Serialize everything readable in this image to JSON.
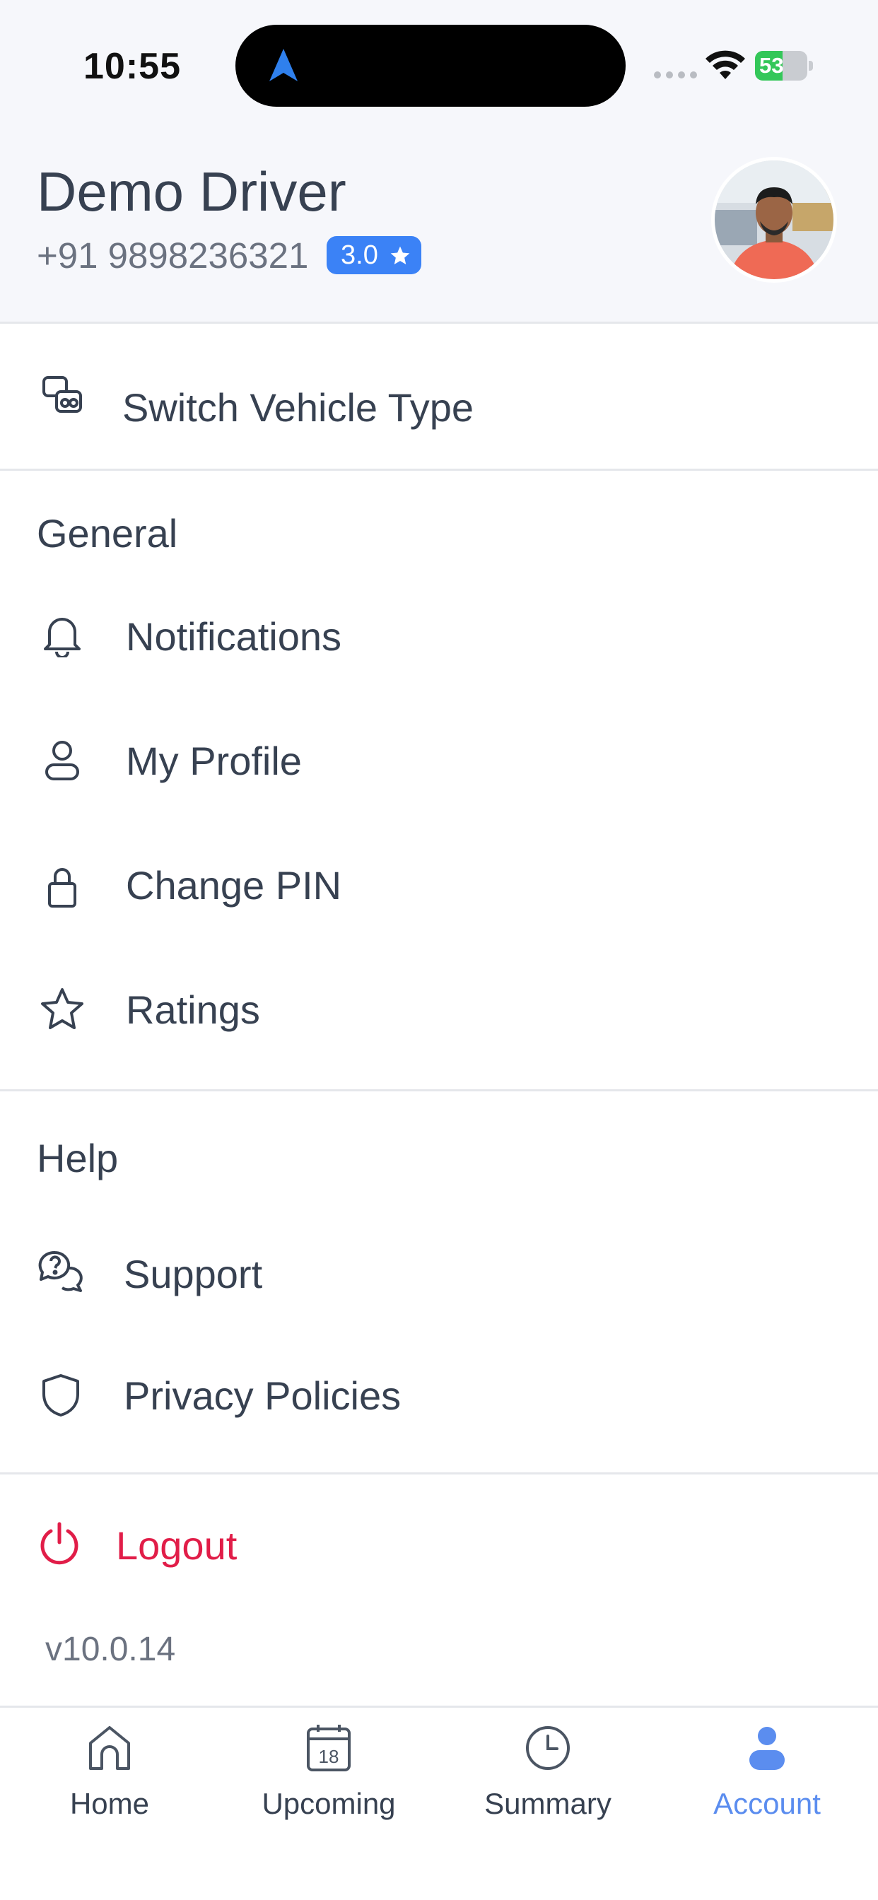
{
  "status_bar": {
    "time": "10:55",
    "battery_percent": "53",
    "battery_level": 0.53
  },
  "profile": {
    "name": "Demo Driver",
    "phone": "+91 9898236321",
    "rating": "3.0"
  },
  "menu": {
    "switch_vehicle": "Switch Vehicle Type",
    "general_title": "General",
    "general_items": [
      {
        "label": "Notifications",
        "icon": "bell-icon"
      },
      {
        "label": "My Profile",
        "icon": "user-icon"
      },
      {
        "label": "Change PIN",
        "icon": "lock-icon"
      },
      {
        "label": "Ratings",
        "icon": "star-icon"
      }
    ],
    "help_title": "Help",
    "help_items": [
      {
        "label": "Support",
        "icon": "support-chat-icon"
      },
      {
        "label": "Privacy Policies",
        "icon": "shield-icon"
      }
    ],
    "logout": "Logout",
    "version": "v10.0.14"
  },
  "tabs": [
    {
      "label": "Home",
      "icon": "home-icon",
      "active": false
    },
    {
      "label": "Upcoming",
      "icon": "calendar-icon",
      "calendar_day": "18",
      "active": false
    },
    {
      "label": "Summary",
      "icon": "clock-icon",
      "active": false
    },
    {
      "label": "Account",
      "icon": "person-icon",
      "active": true
    }
  ],
  "colors": {
    "accent": "#3b82f6",
    "active_tab": "#5b8def",
    "logout": "#e11d48",
    "header_bg": "#f6f7fb",
    "battery_green": "#34c759"
  }
}
